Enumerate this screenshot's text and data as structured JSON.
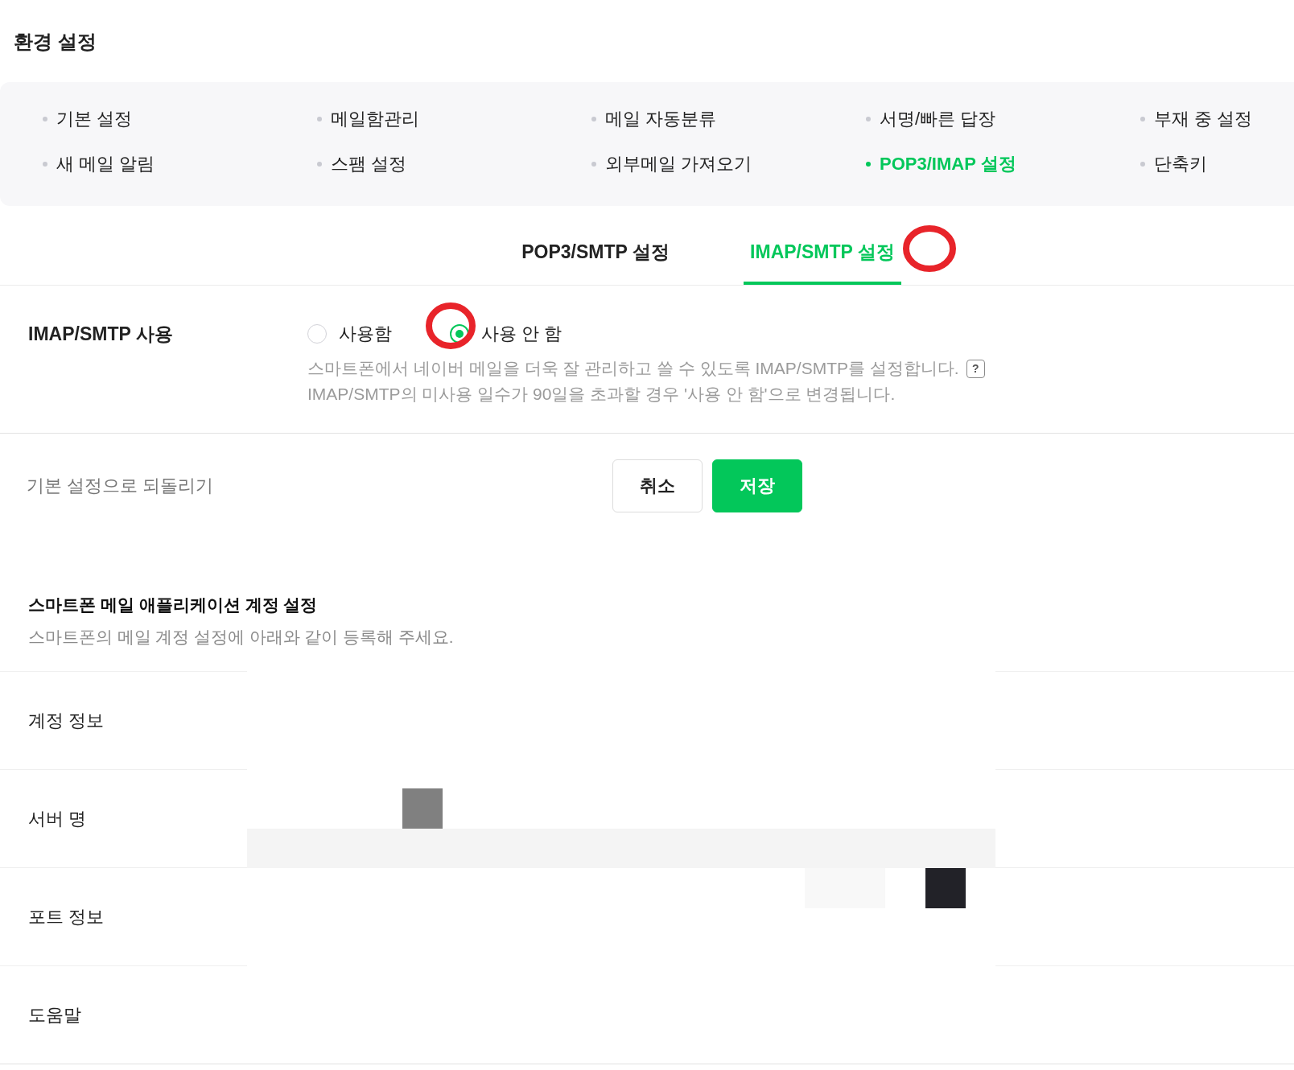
{
  "page": {
    "title": "환경 설정"
  },
  "nav": {
    "items": [
      {
        "label": "기본 설정",
        "selected": false
      },
      {
        "label": "메일함관리",
        "selected": false
      },
      {
        "label": "메일 자동분류",
        "selected": false
      },
      {
        "label": "서명/빠른 답장",
        "selected": false
      },
      {
        "label": "부재 중 설정",
        "selected": false
      },
      {
        "label": "새 메일 알림",
        "selected": false
      },
      {
        "label": "스팸 설정",
        "selected": false
      },
      {
        "label": "외부메일 가져오기",
        "selected": false
      },
      {
        "label": "POP3/IMAP 설정",
        "selected": true
      },
      {
        "label": "단축키",
        "selected": false
      }
    ]
  },
  "tabs": [
    {
      "label": "POP3/SMTP 설정",
      "selected": false
    },
    {
      "label": "IMAP/SMTP 설정",
      "selected": true
    }
  ],
  "imap_setting": {
    "label": "IMAP/SMTP 사용",
    "options": [
      {
        "label": "사용함",
        "selected": false
      },
      {
        "label": "사용 안 함",
        "selected": true
      }
    ],
    "description": [
      "스마트폰에서 네이버 메일을 더욱 잘 관리하고 쓸 수 있도록 IMAP/SMTP를 설정합니다.",
      "IMAP/SMTP의 미사용 일수가 90일을 초과할 경우 '사용 안 함'으로 변경됩니다."
    ],
    "help": "?"
  },
  "actions": {
    "reset": "기본 설정으로 되돌리기",
    "buttons": [
      {
        "label": "취소",
        "kind": "secondary"
      },
      {
        "label": "저장",
        "kind": "primary"
      }
    ]
  },
  "account": {
    "title": "스마트폰 메일 애플리케이션 계정 설정",
    "subtitle": "스마트폰의 메일 계정 설정에 아래와 같이 등록해 주세요.",
    "rows": [
      "계정 정보",
      "서버 명",
      "포트 정보",
      "도움말"
    ]
  }
}
